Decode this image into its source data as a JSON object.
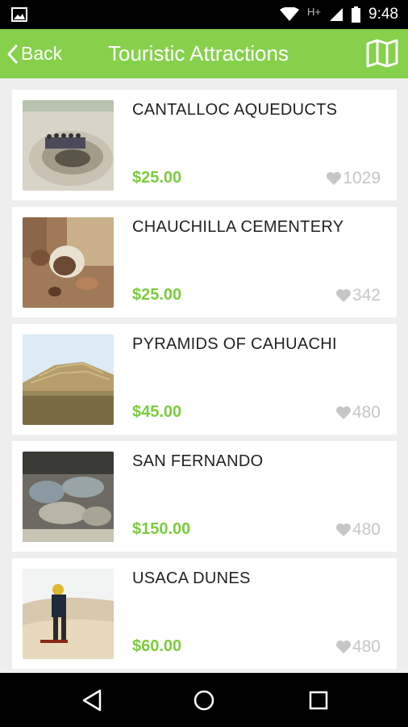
{
  "status_bar": {
    "time": "9:48",
    "network": "H+",
    "icons": [
      "image-notification-icon",
      "wifi-icon",
      "signal-icon",
      "battery-icon"
    ]
  },
  "app_bar": {
    "back_label": "Back",
    "title": "Touristic Attractions",
    "map_icon": "map-icon",
    "color": "#86d04b"
  },
  "attractions": [
    {
      "name": "CANTALLOC AQUEDUCTS",
      "price": "$25.00",
      "likes": "1029"
    },
    {
      "name": "CHAUCHILLA CEMENTERY",
      "price": "$25.00",
      "likes": "342"
    },
    {
      "name": "PYRAMIDS OF CAHUACHI",
      "price": "$45.00",
      "likes": "480"
    },
    {
      "name": "SAN FERNANDO",
      "price": "$150.00",
      "likes": "480"
    },
    {
      "name": "USACA DUNES",
      "price": "$60.00",
      "likes": "480"
    }
  ],
  "nav_bar": {
    "icons": [
      "back-nav-icon",
      "home-nav-icon",
      "recents-nav-icon"
    ]
  },
  "colors": {
    "price": "#7ccc3e",
    "likes": "#c6c6c6",
    "accent": "#86d04b"
  }
}
